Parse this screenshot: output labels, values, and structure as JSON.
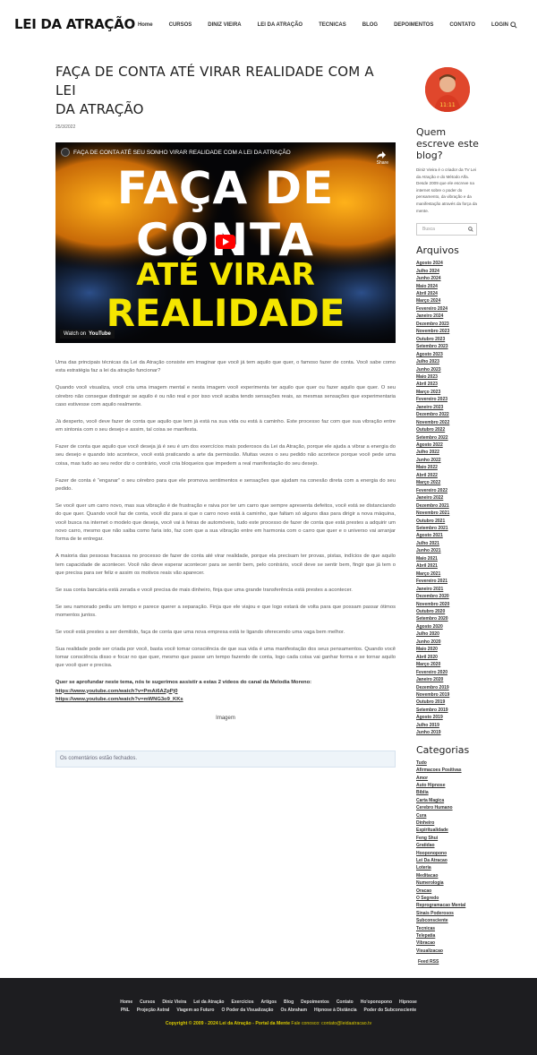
{
  "header": {
    "logo": "LEI DA ATRAÇÃO",
    "nav": [
      "Home",
      "CURSOS",
      "DINIZ VIEIRA",
      "LEI DA ATRAÇÃO",
      "TECNICAS",
      "BLOG",
      "DEPOIMENTOS",
      "CONTATO",
      "LOGIN"
    ]
  },
  "post": {
    "title_line1": "FAÇA DE CONTA ATÉ VIRAR REALIDADE COM A LEI",
    "title_line2": "DA ATRAÇÃO",
    "date": "25/3/2022",
    "video": {
      "title": "FAÇA DE CONTA ATÉ SEU SONHO VIRAR REALIDADE COM A LEI DA ATRAÇÃO",
      "share": "Share",
      "line1": "FAÇA DE",
      "line2": "CONTA",
      "line3": "ATÉ VIRAR",
      "line4": "REALIDADE",
      "watch_on": "Watch on",
      "yt": "YouTube"
    },
    "paragraphs": [
      "Uma das principais técnicas da Lei da Atração consiste em imaginar que você já tem aquilo que quer, o famoso fazer de conta. Você sabe como esta estratégia faz a lei da atração funcionar?",
      "Quando você visualiza, você cria uma imagem mental e nesta imagem você experimenta ter aquilo que quer ou fazer aquilo que quer. O seu cérebro não consegue distinguir se aquilo é ou não real e por isso você acaba tendo sensações reais, as mesmas sensações que experimentaria caso estivesse com aquilo realmente.",
      "Já desperto, você deve fazer de conta que aquilo que tem já está na sua vida ou está à caminho. Este processo faz com que sua vibração entre em sintonia com o seu desejo e assim, tal coisa se manifesta.",
      "Fazer de conta que aquilo que você deseja já é seu é um dos exercícios mais poderosos da Lei da Atração, porque ele ajuda a vibrar a energia do seu desejo e quando isto acontece, você está praticando a arte da permissão. Muitas vezes o seu pedido não acontece porque você pede uma coisa, mas tudo ao seu redor diz o contrário, você cria bloqueios que impedem a real manifestação do seu desejo.",
      "Fazer de conta é “enganar” o seu cérebro para que ele promova sentimentos e sensações que ajudam na conexão direta com a energia do seu pedido.",
      "Se você quer um carro novo, mas sua vibração é de frustração e raiva por ter um carro que sempre apresenta defeitos, você está se distanciando do que quer. Quando você faz de conta, você diz para si que o carro novo está à caminho, que faltam só alguns dias para dirigir a nova máquina, você busca na internet o modelo que deseja, você vai à feiras de automóveis, tudo este processo de fazer de conta que está prestes a adquirir um novo carro, mesmo que não saiba como faria isto, faz com que a sua vibração entre em harmonia com o carro que quer e o universo vai arranjar forma de te entregar.",
      "A maioria das pessoas fracassa no processo de fazer de conta até virar realidade, porque ela precisam ter provas, pistas, indícios de que aquilo tem capacidade de acontecer. Você não deve esperar acontecer para se sentir bem, pelo contrário, você deve se sentir bem, fingir que já tem o que precisa para ser feliz e assim os motivos reais vão aparecer.",
      "Se sua conta bancária está zerada e você precisa de mais dinheiro, finja que uma grande transferência está prestes a acontecer.",
      "Se seu namorado pediu um tempo e parece querer a separação. Finja que ele viajou e que logo estará de volta para que possam passar ótimos momentos juntos.",
      "Se você está prestes a ser demitido, faça de conta que uma nova empresa está te ligando oferecendo uma vaga bem melhor.",
      "Sua realidade pode ser criada por você, basta você tomar consciência de que sua vida é uma manifestação dos seus pensamentos. Quando você tomar consciência disso e focar no que quer, mesmo que passe um tempo fazendo de conta, logo cada coisa vai ganhar forma e se tornar aquilo que você quer e precisa."
    ],
    "suggest": "Quer se aprofundar neste tema, nós te sugerimos assistir a estas 2 vídeos do canal da Melodia Moreno:",
    "links": [
      "https://www.youtube.com/watch?v=PmAi6AZpPj0",
      "https://www.youtube.com/watch?v=mWNG3o9_KKs"
    ],
    "image_alt": "Imagem",
    "comments_closed": "Os comentários estão fechados."
  },
  "sidebar": {
    "author_title": "Quem escreve este blog?",
    "about": "Diniz Vieira é o criador da TV Lei da Atração e do Método Alfa. Desde 2009 que ele escreve na internet sobre o poder do pensamento, da vibração e da manifestação através da força da mente.",
    "search_placeholder": "Busca",
    "archives_title": "Arquivos",
    "archives": [
      "Agosto 2024",
      "Julho 2024",
      "Junho 2024",
      "Maio 2024",
      "Abril 2024",
      "Março 2024",
      "Fevereiro 2024",
      "Janeiro 2024",
      "Dezembro 2023",
      "Novembro 2023",
      "Outubro 2023",
      "Setembro 2023",
      "Agosto 2023",
      "Julho 2023",
      "Junho 2023",
      "Maio 2023",
      "Abril 2023",
      "Março 2023",
      "Fevereiro 2023",
      "Janeiro 2023",
      "Dezembro 2022",
      "Novembro 2022",
      "Outubro 2022",
      "Setembro 2022",
      "Agosto 2022",
      "Julho 2022",
      "Junho 2022",
      "Maio 2022",
      "Abril 2022",
      "Março 2022",
      "Fevereiro 2022",
      "Janeiro 2022",
      "Dezembro 2021",
      "Novembro 2021",
      "Outubro 2021",
      "Setembro 2021",
      "Agosto 2021",
      "Julho 2021",
      "Junho 2021",
      "Maio 2021",
      "Abril 2021",
      "Março 2021",
      "Fevereiro 2021",
      "Janeiro 2021",
      "Dezembro 2020",
      "Novembro 2020",
      "Outubro 2020",
      "Setembro 2020",
      "Agosto 2020",
      "Julho 2020",
      "Junho 2020",
      "Maio 2020",
      "Abril 2020",
      "Março 2020",
      "Fevereiro 2020",
      "Janeiro 2020",
      "Dezembro 2019",
      "Novembro 2019",
      "Outubro 2019",
      "Setembro 2019",
      "Agosto 2019",
      "Julho 2019",
      "Junho 2019"
    ],
    "categories_title": "Categorias",
    "categories": [
      "Tudo",
      "Afirmacoes Positivas",
      "Amor",
      "Auto Hipnose",
      "Bíblia",
      "Carta Magica",
      "Cerebro Humano",
      "Cura",
      "Dinheiro",
      "Espiritualidade",
      "Feng Shui",
      "Gratidao",
      "Hooponopono",
      "Lei Da Atracao",
      "Loteria",
      "Meditacao",
      "Numerologia",
      "Oracao",
      "O Segredo",
      "Reprogramacao Mental",
      "Sinais Poderosos",
      "Subconsciente",
      "Tecnicas",
      "Telepatia",
      "Vibracao",
      "Visualizacao"
    ],
    "feed": "Feed RSS"
  },
  "footer": {
    "links_row1": [
      "Home",
      "Cursos",
      "Diniz Vieira",
      "Lei da Atração",
      "Exercícios",
      "Artigos",
      "Blog",
      "Depoimentos",
      "Contato",
      "Ho'oponopono",
      "Hipnose"
    ],
    "links_row2": [
      "PNL",
      "Projeção Astral",
      "Viagem ao Futuro",
      "O Poder da Visualização",
      "Os Abraham",
      "Hipnose à Distância",
      "Poder do Subconsciente"
    ],
    "copyright": "Copyright © 2009 - 2024 Lei da Atração - Portal da Mente",
    "contact": "Fale conosco: contato@leidaatracao.tv"
  }
}
